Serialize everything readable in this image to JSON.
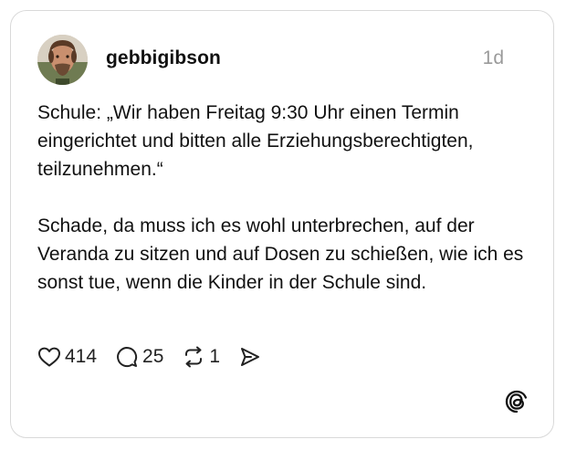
{
  "post": {
    "username": "gebbigibson",
    "timestamp": "1d",
    "paragraphs": [
      "Schule: „Wir haben Freitag 9:30 Uhr einen Termin eingerichtet und bitten alle Erziehungsberechtigten, teilzunehmen.“",
      "Schade, da muss ich es wohl unterbrechen, auf der Veranda zu sitzen und auf Dosen zu schießen, wie ich es sonst tue, wenn die Kinder in der Schule sind."
    ]
  },
  "actions": {
    "likes": "414",
    "replies": "25",
    "reposts": "1"
  },
  "icons": {
    "like": "heart-icon",
    "reply": "comment-icon",
    "repost": "repost-icon",
    "share": "send-icon",
    "brand": "threads-logo-icon"
  }
}
